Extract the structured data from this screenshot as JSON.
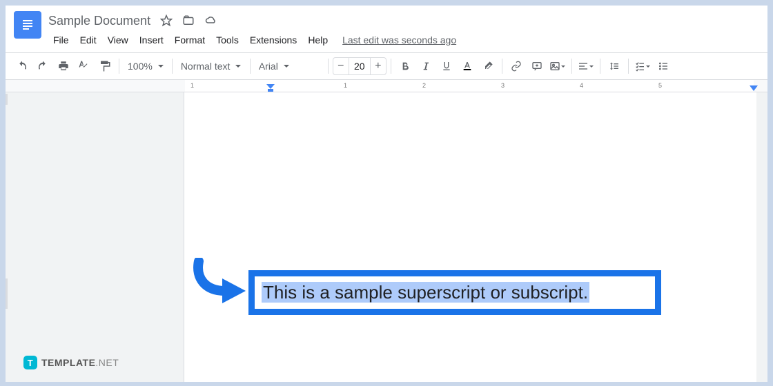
{
  "header": {
    "title": "Sample Document",
    "last_edit": "Last edit was seconds ago"
  },
  "menu": {
    "file": "File",
    "edit": "Edit",
    "view": "View",
    "insert": "Insert",
    "format": "Format",
    "tools": "Tools",
    "extensions": "Extensions",
    "help": "Help"
  },
  "toolbar": {
    "zoom": "100%",
    "style": "Normal text",
    "font": "Arial",
    "size": "20",
    "minus": "−",
    "plus": "+"
  },
  "ruler": {
    "t1": "1",
    "t2": "1",
    "t3": "2",
    "t4": "3",
    "t5": "4",
    "t6": "5"
  },
  "document": {
    "text": "This is a sample superscript or subscript."
  },
  "watermark": {
    "brand": "TEMPLATE",
    "suffix": ".NET",
    "icon": "T"
  }
}
